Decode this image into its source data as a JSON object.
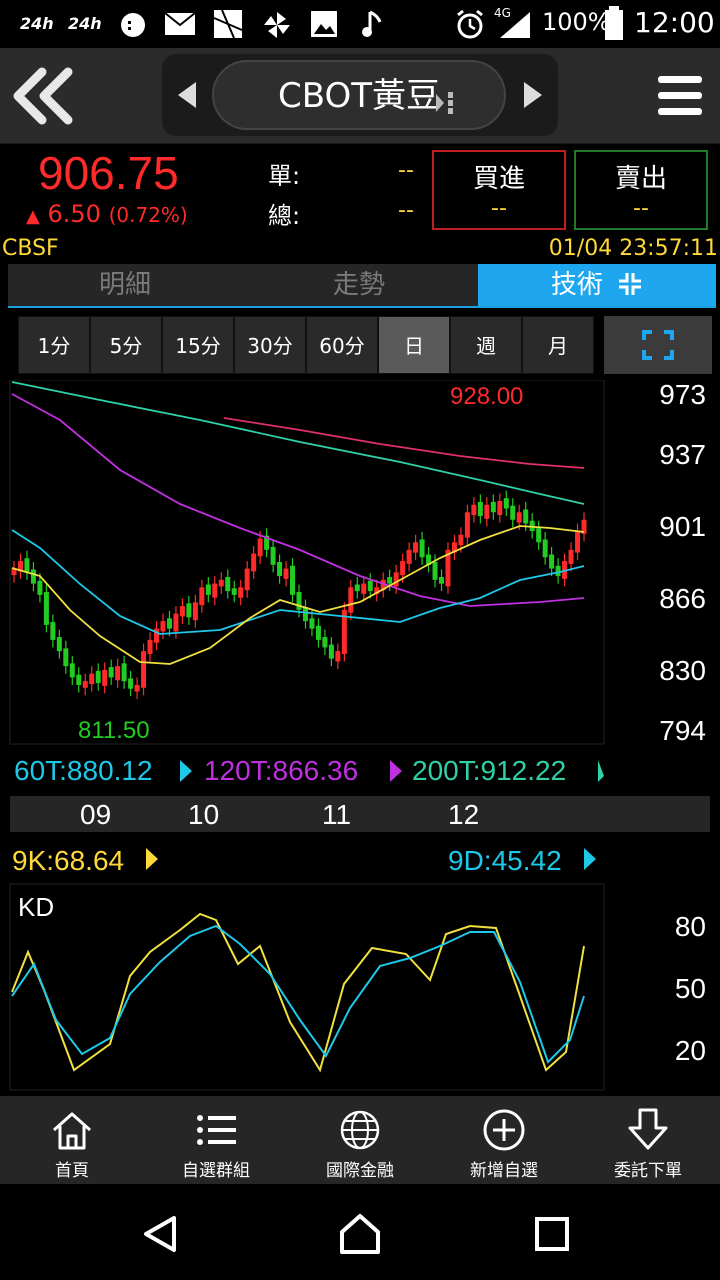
{
  "status_bar": {
    "left_icons": [
      "24-hour-icon",
      "24-hour-icon",
      "chat-icon",
      "mail-icon",
      "gallery-icon",
      "pinwheel-icon",
      "image-icon",
      "music-icon"
    ],
    "battery": "100%",
    "time": "12:00",
    "network": "4G"
  },
  "header": {
    "title": "CBOT黃豆"
  },
  "quote": {
    "price": "906.75",
    "change": "6.50",
    "change_pct": "(0.72%)",
    "single_label": "單:",
    "single_value": "--",
    "total_label": "總:",
    "total_value": "--",
    "buy_label": "買進",
    "buy_value": "--",
    "sell_label": "賣出",
    "sell_value": "--"
  },
  "info": {
    "exchange": "CBSF",
    "datetime": "01/04 23:57:11"
  },
  "tabs": [
    {
      "label": "明細"
    },
    {
      "label": "走勢"
    },
    {
      "label": "技術"
    }
  ],
  "periods": [
    "1分",
    "5分",
    "15分",
    "30分",
    "60分",
    "日",
    "週",
    "月"
  ],
  "active_period": "日",
  "price_chart": {
    "high_label": "928.00",
    "low_label": "811.50",
    "y_ticks": [
      "973",
      "937",
      "901",
      "866",
      "830",
      "794"
    ],
    "ma60": "60T:880.12",
    "ma120": "120T:866.36",
    "ma200": "200T:912.22",
    "months": [
      "09",
      "10",
      "11",
      "12"
    ]
  },
  "kd_chart": {
    "title": "KD",
    "k_label": "9K:68.64",
    "d_label": "9D:45.42",
    "y_ticks": [
      "80",
      "50",
      "20"
    ]
  },
  "colors": {
    "up": "#ff2a2a",
    "down": "#22cc22",
    "accent": "#1ea6ee",
    "yellow": "#ffd83a",
    "ma60": "#1ec8e8",
    "ma120": "#c030e0",
    "ma200": "#30d0a8",
    "ma_red": "#e03070",
    "ma_yellow": "#f0e040"
  },
  "bottom_nav": [
    {
      "label": "首頁",
      "icon": "home-icon"
    },
    {
      "label": "自選群組",
      "icon": "list-icon"
    },
    {
      "label": "國際金融",
      "icon": "globe-icon"
    },
    {
      "label": "新增自選",
      "icon": "add-circle-icon"
    },
    {
      "label": "委託下單",
      "icon": "order-arrow-icon"
    }
  ],
  "system_nav": [
    "back-icon",
    "home-icon",
    "recents-icon"
  ]
}
